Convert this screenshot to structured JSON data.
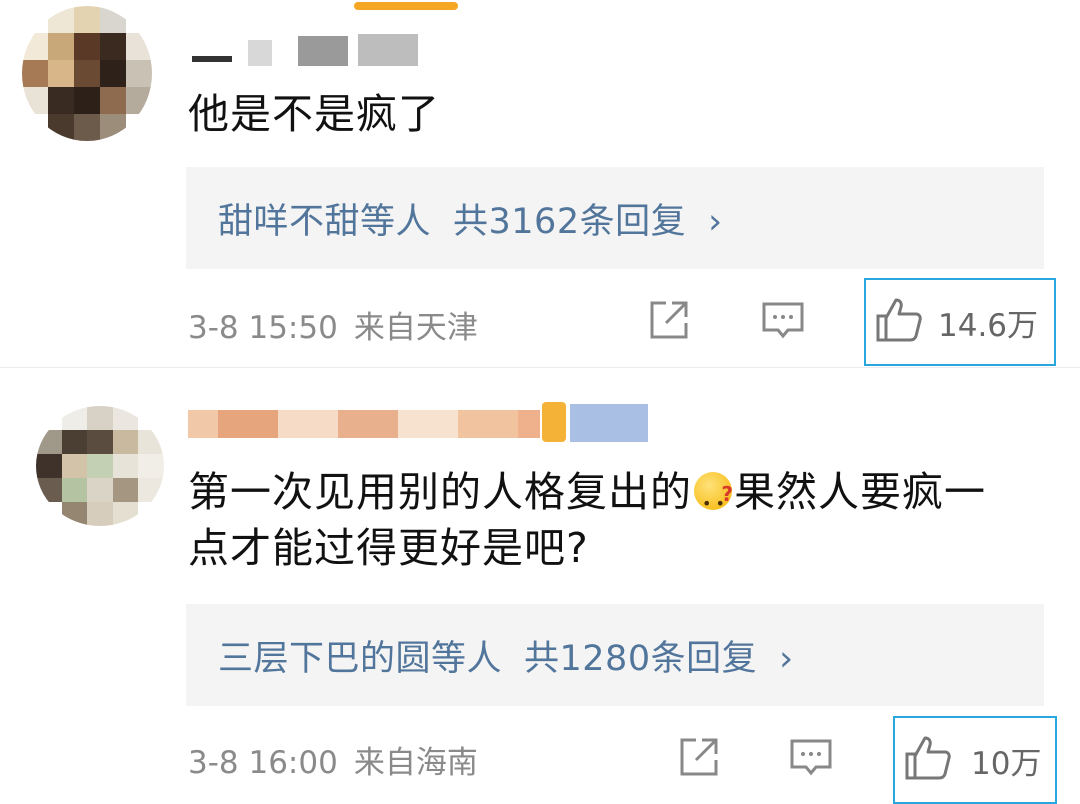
{
  "comments": [
    {
      "text": "他是不是疯了",
      "reply_summary": {
        "names": "甜咩不甜等人",
        "count_text": "共3162条回复",
        "chevron": "›"
      },
      "time": "3-8 15:50",
      "location": "来自天津",
      "likes": "14.6万"
    },
    {
      "text_line1": "第一次见用别的人格复出的",
      "text_line1_after_emoji": "果然人要疯一",
      "text_line2": "点才能过得更好是吧?",
      "emoji": "confused-face",
      "reply_summary": {
        "names": "三层下巴的圆等人",
        "count_text": "共1280条回复",
        "chevron": "›"
      },
      "time": "3-8 16:00",
      "location": "来自海南",
      "likes": "10万"
    }
  ],
  "colors": {
    "link": "#52759b",
    "meta": "#8a8a8a",
    "highlight_border": "#29a8e0",
    "reply_bg": "#f4f4f4"
  },
  "icons": [
    "share-icon",
    "comment-icon",
    "thumbs-up-icon"
  ]
}
